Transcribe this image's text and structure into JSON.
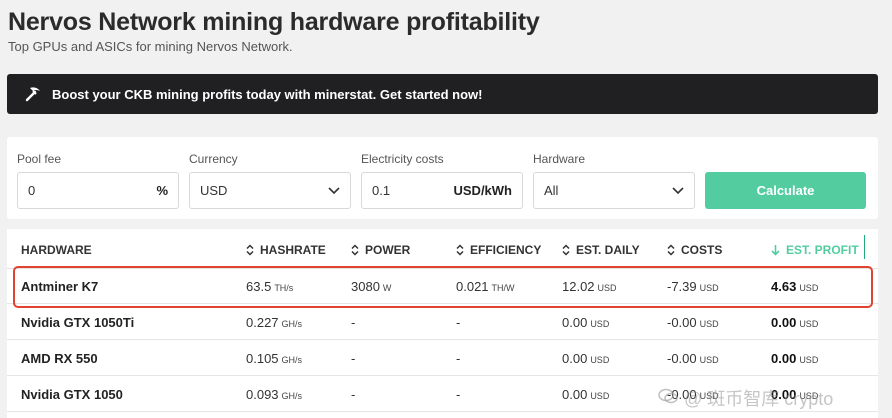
{
  "page": {
    "title": "Nervos Network mining hardware profitability",
    "subtitle": "Top GPUs and ASICs for mining Nervos Network."
  },
  "banner": {
    "icon": "pickaxe-icon",
    "text": "Boost your CKB mining profits today with minerstat. Get started now!"
  },
  "filters": {
    "pool_fee": {
      "label": "Pool fee",
      "value": "0",
      "suffix": "%"
    },
    "currency": {
      "label": "Currency",
      "value": "USD"
    },
    "electricity": {
      "label": "Electricity costs",
      "value": "0.1",
      "suffix": "USD/kWh"
    },
    "hardware": {
      "label": "Hardware",
      "value": "All"
    },
    "calculate_label": "Calculate"
  },
  "table": {
    "headers": {
      "hardware": "HARDWARE",
      "hashrate": "HASHRATE",
      "power": "POWER",
      "efficiency": "EFFICIENCY",
      "est_daily": "EST. DAILY",
      "costs": "COSTS",
      "est_profit": "EST. PROFIT"
    },
    "rows": [
      {
        "hardware": "Antminer K7",
        "hashrate": "63.5",
        "hashrate_unit": "TH/s",
        "power": "3080",
        "power_unit": "W",
        "efficiency": "0.021",
        "efficiency_unit": "TH/W",
        "est_daily": "12.02",
        "est_daily_unit": "USD",
        "costs": "-7.39",
        "costs_unit": "USD",
        "est_profit": "4.63",
        "est_profit_unit": "USD"
      },
      {
        "hardware": "Nvidia GTX 1050Ti",
        "hashrate": "0.227",
        "hashrate_unit": "GH/s",
        "power": "-",
        "power_unit": "",
        "efficiency": "-",
        "efficiency_unit": "",
        "est_daily": "0.00",
        "est_daily_unit": "USD",
        "costs": "-0.00",
        "costs_unit": "USD",
        "est_profit": "0.00",
        "est_profit_unit": "USD"
      },
      {
        "hardware": "AMD RX 550",
        "hashrate": "0.105",
        "hashrate_unit": "GH/s",
        "power": "-",
        "power_unit": "",
        "efficiency": "-",
        "efficiency_unit": "",
        "est_daily": "0.00",
        "est_daily_unit": "USD",
        "costs": "-0.00",
        "costs_unit": "USD",
        "est_profit": "0.00",
        "est_profit_unit": "USD"
      },
      {
        "hardware": "Nvidia GTX 1050",
        "hashrate": "0.093",
        "hashrate_unit": "GH/s",
        "power": "-",
        "power_unit": "",
        "efficiency": "-",
        "efficiency_unit": "",
        "est_daily": "0.00",
        "est_daily_unit": "USD",
        "costs": "-0.00",
        "costs_unit": "USD",
        "est_profit": "0.00",
        "est_profit_unit": "USD"
      }
    ]
  },
  "watermark": {
    "text": "@ 斑币智库 crypto"
  },
  "colors": {
    "accent": "#53cda0",
    "highlight": "#e0442f",
    "banner_bg": "#202022"
  }
}
